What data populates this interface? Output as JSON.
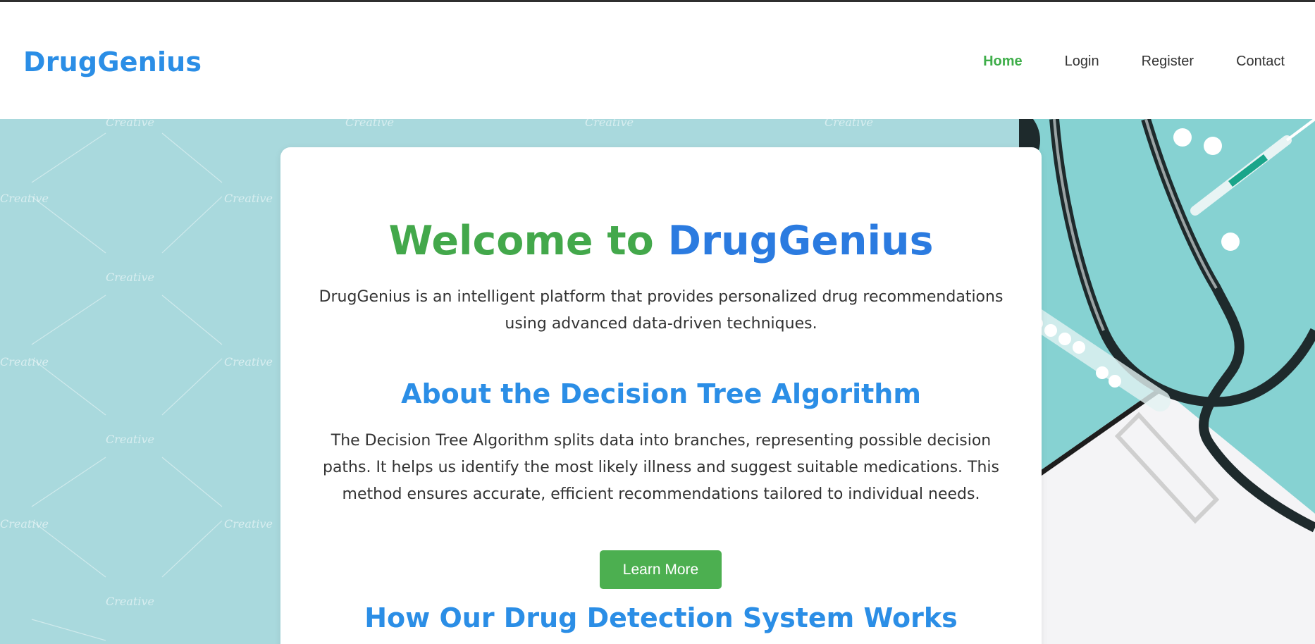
{
  "header": {
    "brand": "DrugGenius",
    "nav": [
      {
        "label": "Home",
        "active": true
      },
      {
        "label": "Login",
        "active": false
      },
      {
        "label": "Register",
        "active": false
      },
      {
        "label": "Contact",
        "active": false
      }
    ]
  },
  "hero": {
    "background_color": "#a9d9dd",
    "title_part1": "Welcome to",
    "title_part2": "DrugGenius",
    "intro": "DrugGenius is an intelligent platform that provides personalized drug recommendations using advanced data-driven techniques.",
    "about_heading": "About the Decision Tree Algorithm",
    "about_text": "The Decision Tree Algorithm splits data into branches, representing possible decision paths. It helps us identify the most likely illness and suggest suitable medications. This method ensures accurate, efficient recommendations tailored to individual needs.",
    "learn_more_label": "Learn More",
    "how_heading": "How Our Drug Detection System Works"
  },
  "colors": {
    "brand_blue": "#2b8ee6",
    "title_blue": "#2b7be0",
    "accent_green": "#43a84b",
    "button_green": "#4caf50"
  }
}
